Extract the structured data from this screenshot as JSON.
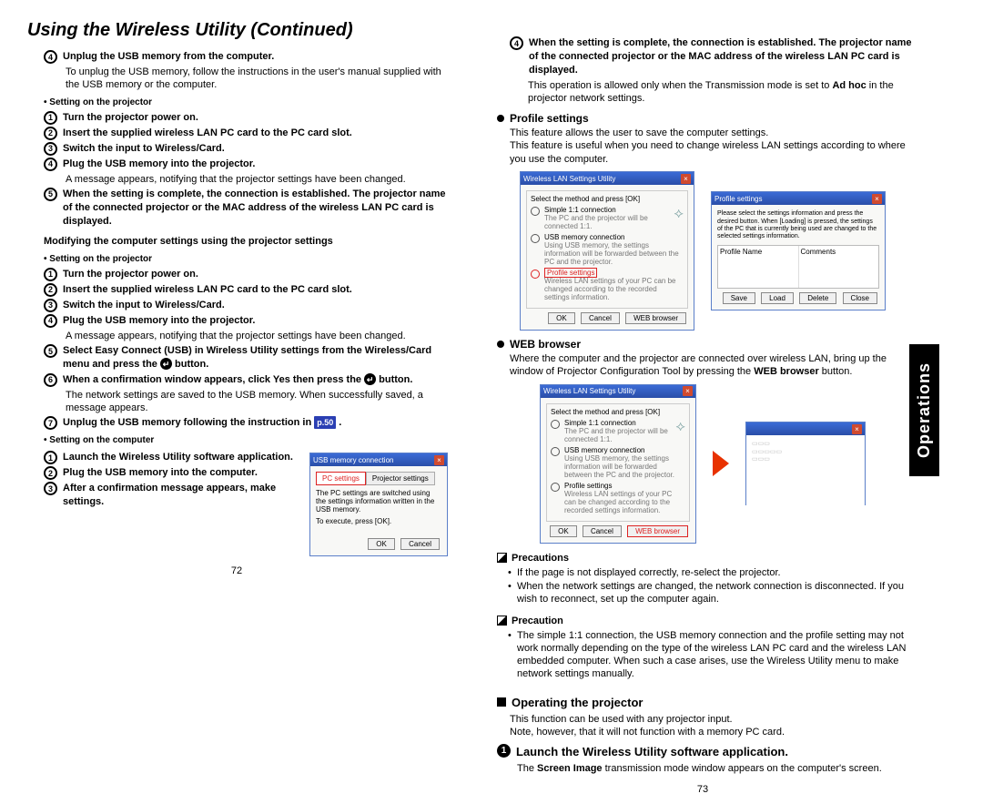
{
  "header_title": "Using the Wireless Utility (Continued)",
  "side_tab": "Operations",
  "left": {
    "step4_unplug": "Unplug the USB memory from the computer.",
    "step4_unplug_detail": "To unplug the USB memory, follow the instructions in the user's manual supplied with the USB memory or the computer.",
    "setting_on_projector": "• Setting on the projector",
    "sp1": "Turn the projector power on.",
    "sp2": "Insert the supplied wireless LAN PC card to the PC card slot.",
    "sp3": "Switch the input to Wireless/Card.",
    "sp4": "Plug the USB memory into the projector.",
    "sp4_detail": "A message appears, notifying that the projector settings have been changed.",
    "sp5": "When the setting is complete, the connection is established. The projector name of the connected projector or the MAC address of the wireless LAN PC card is displayed.",
    "mod_heading": "Modifying the computer settings using the projector settings",
    "sc5": "Select Easy Connect (USB) in Wireless Utility settings from the Wireless/Card menu and press the ",
    "sc5_end": " button.",
    "sc6": "When a confirmation window appears, click Yes then press the ",
    "sc6_end": "button.",
    "sc6_detail": "The network settings are saved to the USB memory. When successfully saved, a message appears.",
    "sc7": "Unplug the USB memory following the instruction in ",
    "page_ref": "p.50",
    "sc7_end": " .",
    "setting_on_computer": "• Setting on the computer",
    "comp1": "Launch the Wireless Utility software application.",
    "comp2": "Plug the USB memory into the computer.",
    "comp3": "After a confirmation message appears, make settings.",
    "fig1": {
      "title": "USB memory connection",
      "tab1": "PC settings",
      "tab2": "Projector settings",
      "line1": "The PC settings are switched using the settings information written in the USB memory.",
      "line2": "To execute, press [OK].",
      "ok": "OK",
      "cancel": "Cancel"
    }
  },
  "right": {
    "r4": "When the setting is complete, the connection is established. The projector name of the connected projector or the MAC address of the wireless LAN PC card is displayed.",
    "r4_detail_a": "This operation is allowed only when the Transmission mode is set to ",
    "r4_detail_adhoc": "Ad hoc",
    "r4_detail_b": " in the projector network settings.",
    "profile_head": "Profile settings",
    "profile_p1": "This feature allows the user to save the computer settings.",
    "profile_p2": "This feature is useful when you need to change wireless LAN settings according to where you use the computer.",
    "fig_a": {
      "title": "Wireless LAN Settings Utility",
      "group": "Select the method and press [OK]",
      "opt1_label": "Simple 1:1 connection",
      "opt1_desc": "The PC and the projector will be connected 1:1.",
      "opt2_label": "USB memory connection",
      "opt2_desc": "Using USB memory, the settings information will be forwarded between the PC and the projector.",
      "opt3_label": "Profile settings",
      "opt3_desc": "Wireless LAN settings of your PC can be changed according to the recorded settings information.",
      "ok": "OK",
      "cancel": "Cancel",
      "web": "WEB browser"
    },
    "fig_b": {
      "title": "Profile settings",
      "desc": "Please select the settings information and press the desired button. When [Loading] is pressed, the settings of the PC that is currently being used are changed to the selected settings information.",
      "colA": "Profile Name",
      "colB": "Comments",
      "save": "Save",
      "load": "Load",
      "delete": "Delete",
      "close": "Close"
    },
    "web_head": "WEB browser",
    "web_p_a": "Where the computer and the projector are connected over wireless LAN, bring up the window of Projector Configuration Tool by pressing the ",
    "web_p_bold": "WEB browser",
    "web_p_b": " button.",
    "fig_c_web_btn": "WEB browser",
    "precautions_lbl": "Precautions",
    "prec_a": "If the page is not displayed correctly, re-select the projector.",
    "prec_b": "When the network settings are changed, the network connection is disconnected. If you wish to reconnect, set up the computer again.",
    "precaution_lbl": "Precaution",
    "precaution_txt": "The simple 1:1 connection, the USB memory connection and the profile setting may not work normally depending on the type of the wireless LAN PC card and the wireless LAN embedded computer. When such a case arises, use the Wireless Utility menu to make network settings manually.",
    "operating_head": "Operating the projector",
    "operating_p1": "This function can be used with any projector input.",
    "operating_p2": "Note, however, that it will not function with a memory PC card.",
    "launch_step": "Launch the Wireless Utility software application.",
    "launch_detail_a": "The ",
    "launch_detail_bold": "Screen Image",
    "launch_detail_b": " transmission mode window appears on the computer's screen."
  },
  "pagenum_left": "72",
  "pagenum_right": "73"
}
